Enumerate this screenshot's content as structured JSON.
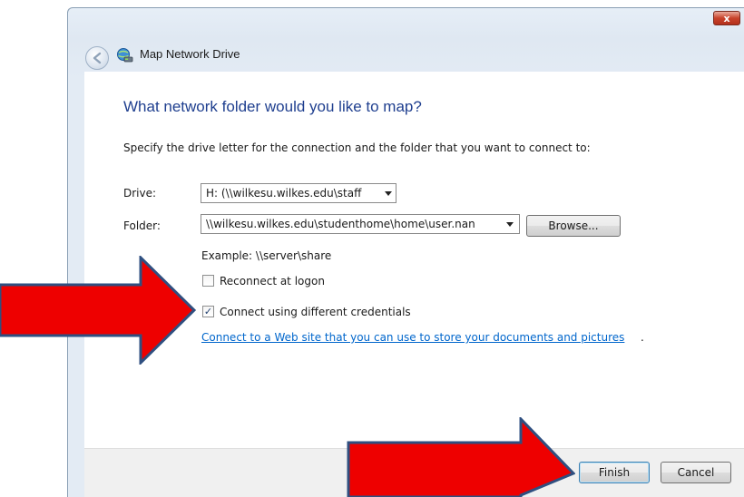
{
  "window": {
    "title": "Map Network Drive",
    "close_label": "x"
  },
  "main": {
    "heading": "What network folder would you like to map?",
    "instruction": "Specify the drive letter for the connection and the folder that you want to connect to:",
    "drive_label": "Drive:",
    "drive_value": "H: (\\\\wilkesu.wilkes.edu\\staff",
    "folder_label": "Folder:",
    "folder_value": "\\\\wilkesu.wilkes.edu\\studenthome\\home\\user.nan",
    "browse_label": "Browse...",
    "example_text": "Example: \\\\server\\share",
    "reconnect_label": "Reconnect at logon",
    "reconnect_checked": false,
    "credentials_label": "Connect using different credentials",
    "credentials_checked": true,
    "web_link": "Connect to a Web site that you can use to store your documents and pictures",
    "web_link_suffix": "."
  },
  "footer": {
    "finish_label": "Finish",
    "cancel_label": "Cancel"
  },
  "colors": {
    "heading": "#1f3f8f",
    "link": "#0066cc",
    "annotation_arrow": "#ee0000",
    "annotation_arrow_outline": "#2f4f80"
  }
}
